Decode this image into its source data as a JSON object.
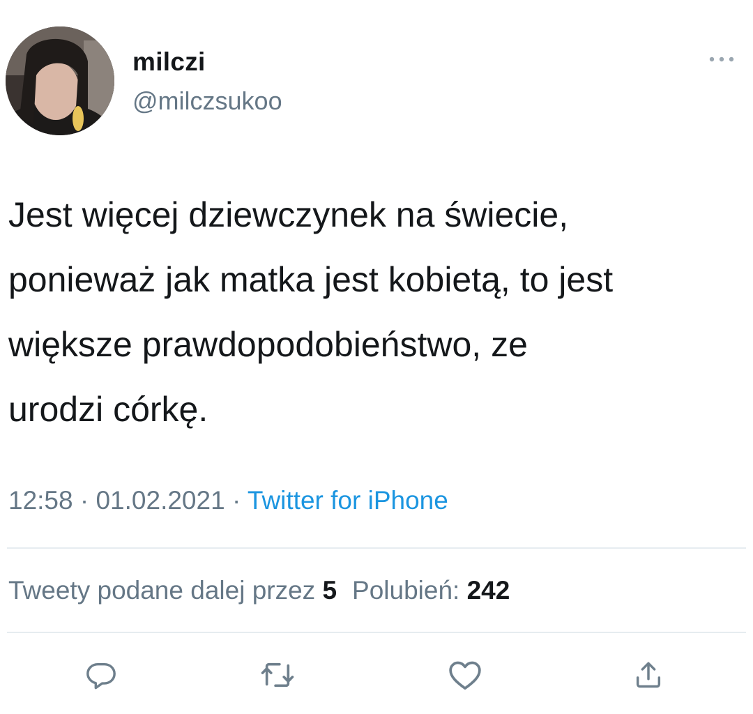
{
  "user": {
    "display_name": "milczi",
    "handle": "@milczsukoo",
    "avatar": "profile-photo"
  },
  "tweet": {
    "text_lines": [
      "Jest więcej dziewczynek na świecie,",
      "ponieważ jak matka jest kobietą, to jest",
      "większe prawdopodobieństwo, ze",
      "urodzi córkę."
    ],
    "time": "12:58",
    "date": "01.02.2021",
    "separator": "·",
    "source": "Twitter for iPhone"
  },
  "stats": {
    "retweets_label": "Tweety podane dalej przez",
    "retweets_count": "5",
    "likes_label": "Polubień:",
    "likes_count": "242"
  },
  "actions": {
    "reply_icon": "reply-icon",
    "retweet_icon": "retweet-icon",
    "like_icon": "heart-icon",
    "share_icon": "share-icon",
    "more_icon": "more-icon"
  },
  "colors": {
    "text": "#14171a",
    "secondary": "#657786",
    "link": "#1b95e0",
    "divider": "#e6ecf0"
  }
}
